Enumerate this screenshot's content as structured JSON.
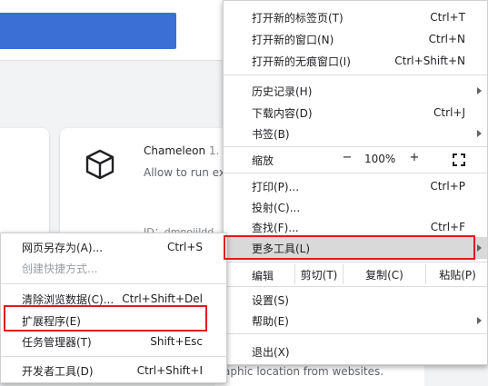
{
  "page": {
    "extension_card": {
      "name": "Chameleon",
      "version": "1.",
      "description": "Allow to run ex",
      "id_text": "ID：dmnoiildd"
    },
    "bottom_text": "aphic location from websites."
  },
  "main_menu": {
    "new_tab": {
      "label": "打开新的标签页(T)",
      "shortcut": "Ctrl+T"
    },
    "new_window": {
      "label": "打开新的窗口(N)",
      "shortcut": "Ctrl+N"
    },
    "new_incognito": {
      "label": "打开新的无痕窗口(I)",
      "shortcut": "Ctrl+Shift+N"
    },
    "history": {
      "label": "历史记录(H)"
    },
    "downloads": {
      "label": "下载内容(D)",
      "shortcut": "Ctrl+J"
    },
    "bookmarks": {
      "label": "书签(B)"
    },
    "zoom": {
      "label": "缩放",
      "minus": "−",
      "value": "100%",
      "plus": "+"
    },
    "print": {
      "label": "打印(P)...",
      "shortcut": "Ctrl+P"
    },
    "cast": {
      "label": "投射(C)..."
    },
    "find": {
      "label": "查找(F)...",
      "shortcut": "Ctrl+F"
    },
    "more_tools": {
      "label": "更多工具(L)"
    },
    "edit": {
      "label": "编辑",
      "cut": "剪切(T)",
      "copy": "复制(C)",
      "paste": "粘贴(P)"
    },
    "settings": {
      "label": "设置(S)"
    },
    "help": {
      "label": "帮助(E)"
    },
    "exit": {
      "label": "退出(X)"
    }
  },
  "sub_menu": {
    "save_page": {
      "label": "网页另存为(A)...",
      "shortcut": "Ctrl+S"
    },
    "create_shortcut": {
      "label": "创建快捷方式..."
    },
    "clear_data": {
      "label": "清除浏览数据(C)...",
      "shortcut": "Ctrl+Shift+Del"
    },
    "extensions": {
      "label": "扩展程序(E)"
    },
    "task_manager": {
      "label": "任务管理器(T)",
      "shortcut": "Shift+Esc"
    },
    "devtools": {
      "label": "开发者工具(D)",
      "shortcut": "Ctrl+Shift+I"
    }
  },
  "colors": {
    "header_blue": "#3b6fd6",
    "highlight": "#d9d9d9",
    "annotation_red": "#e01b1b"
  }
}
